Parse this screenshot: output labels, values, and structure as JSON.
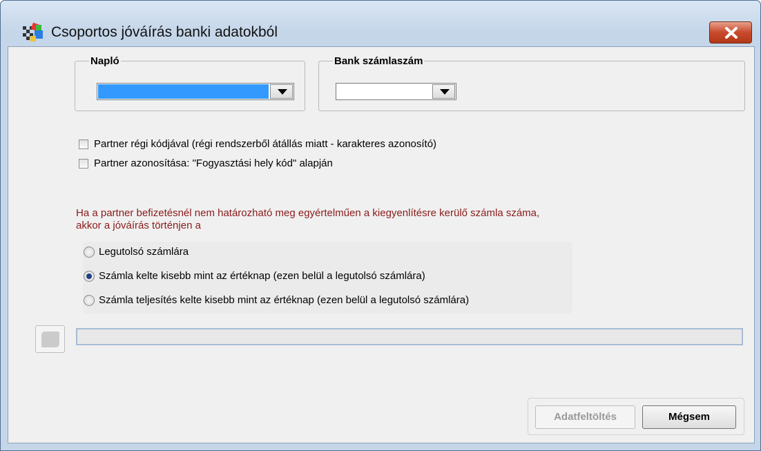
{
  "window": {
    "title": "Csoportos jóváírás banki adatokból",
    "icon": "app-icon",
    "close_icon": "close-icon"
  },
  "naplo": {
    "legend": "Napló",
    "value": "",
    "selected_color": "#3399ff"
  },
  "bank": {
    "legend": "Bank számlaszám",
    "value": ""
  },
  "options": {
    "partner_regi_kod": {
      "label": "Partner régi kódjával (régi rendszerből átállás miatt - karakteres azonosító)",
      "checked": false
    },
    "partner_fogyasztasi": {
      "label": "Partner azonosítása: \"Fogyasztási hely kód\" alapján",
      "checked": false
    }
  },
  "warning": {
    "line1": "Ha a partner befizetésnél nem határozható meg egyértelműen a kiegyenlítésre kerülő számla száma,",
    "line2": "akkor a jóváírás történjen a",
    "color": "#8b1a1a"
  },
  "radios": [
    {
      "label": "Legutolsó számlára",
      "selected": false
    },
    {
      "label": "Számla kelte kisebb mint az értéknap (ezen belül a legutolsó számlára)",
      "selected": true
    },
    {
      "label": "Számla teljesítés kelte kisebb mint az értéknap (ezen belül a legutolsó számlára)",
      "selected": false
    }
  ],
  "progress": {
    "value": 0
  },
  "buttons": {
    "upload_label": "Adatfeltöltés",
    "cancel_label": "Mégsem"
  }
}
